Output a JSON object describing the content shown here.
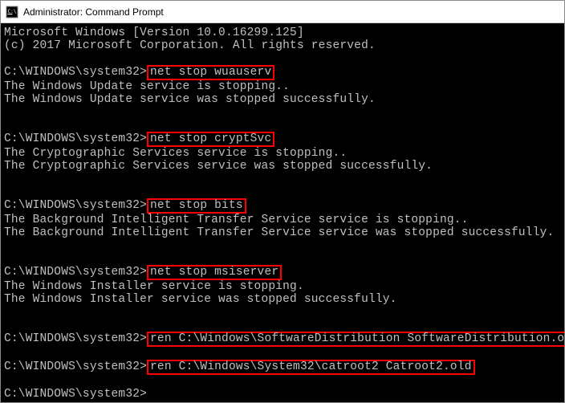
{
  "titlebar": {
    "text": "Administrator: Command Prompt"
  },
  "terminal": {
    "header1": "Microsoft Windows [Version 10.0.16299.125]",
    "header2": "(c) 2017 Microsoft Corporation. All rights reserved.",
    "prompt": "C:\\WINDOWS\\system32>",
    "cmd1": "net stop wuauserv",
    "out1a": "The Windows Update service is stopping..",
    "out1b": "The Windows Update service was stopped successfully.",
    "cmd2": "net stop cryptSvc",
    "out2a": "The Cryptographic Services service is stopping..",
    "out2b": "The Cryptographic Services service was stopped successfully.",
    "cmd3": "net stop bits",
    "out3a": "The Background Intelligent Transfer Service service is stopping..",
    "out3b": "The Background Intelligent Transfer Service service was stopped successfully.",
    "cmd4": "net stop msiserver",
    "out4a": "The Windows Installer service is stopping.",
    "out4b": "The Windows Installer service was stopped successfully.",
    "cmd5": "ren C:\\Windows\\SoftwareDistribution SoftwareDistribution.old",
    "cmd6": "ren C:\\Windows\\System32\\catroot2 Catroot2.old"
  }
}
